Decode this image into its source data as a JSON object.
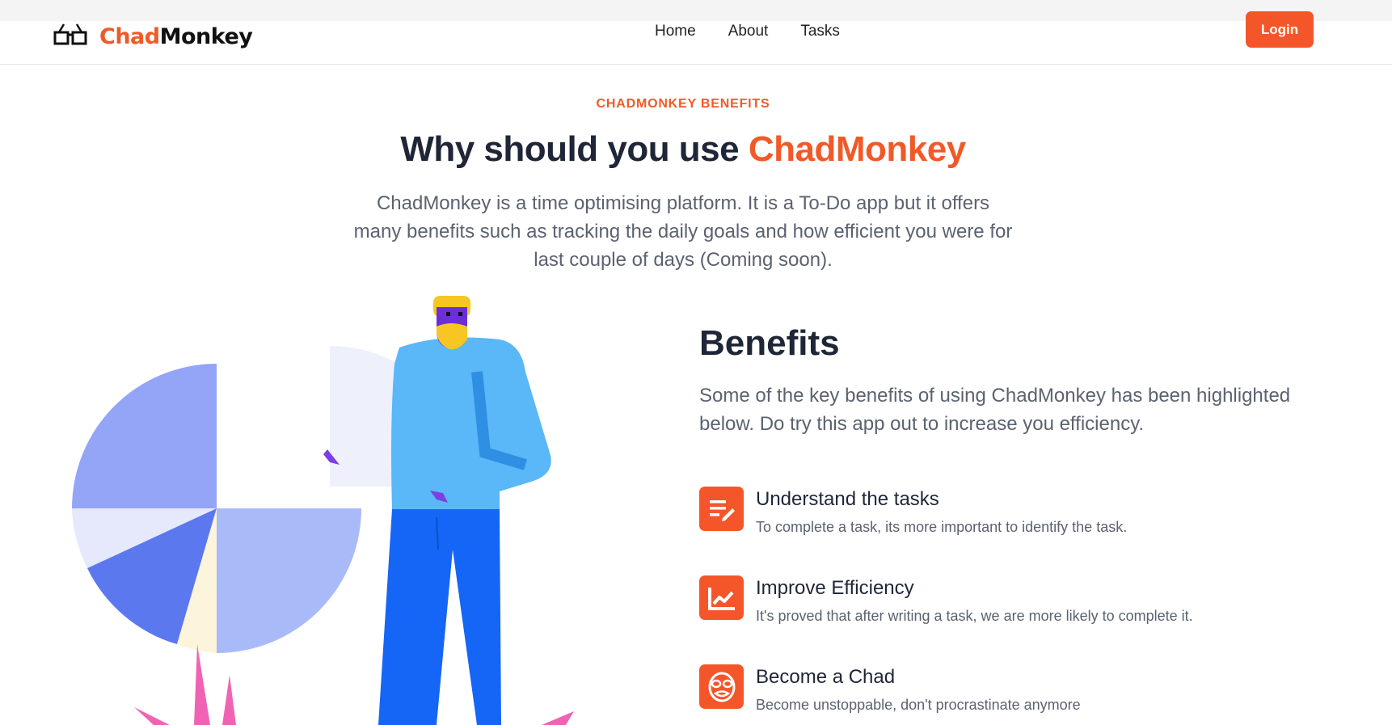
{
  "brand": {
    "part1": "Chad",
    "part2": "Monkey",
    "logo_icon": "glasses-icon"
  },
  "nav": {
    "links": [
      "Home",
      "About",
      "Tasks"
    ],
    "login_label": "Login"
  },
  "section": {
    "eyebrow": "CHADMONKEY BENEFITS",
    "headline_prefix": "Why should you use ",
    "headline_brand": "ChadMonkey",
    "intro": "ChadMonkey is a time optimising platform. It is a To-Do app but it offers many benefits such as tracking the daily goals and how efficient you were for last couple of days (Coming soon)."
  },
  "benefits": {
    "title": "Benefits",
    "description": "Some of the key benefits of using ChadMonkey has been highlighted below. Do try this app out to increase you efficiency.",
    "items": [
      {
        "icon": "edit-list-icon",
        "title": "Understand the tasks",
        "text": "To complete a task, its more important to identify the task."
      },
      {
        "icon": "line-chart-icon",
        "title": "Improve Efficiency",
        "text": "It's proved that after writing a task, we are more likely to complete it."
      },
      {
        "icon": "mask-face-icon",
        "title": "Become a Chad",
        "text": "Become unstoppable, don't procrastinate anymore"
      }
    ]
  },
  "colors": {
    "accent": "#f4562a",
    "heading": "#1e2637",
    "body": "#5b6270"
  }
}
